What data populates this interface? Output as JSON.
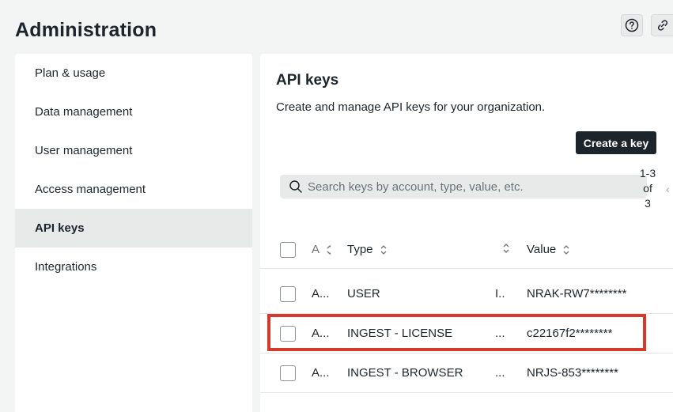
{
  "page": {
    "title": "Administration"
  },
  "top_icons": [
    {
      "name": "help-icon"
    },
    {
      "name": "link-icon"
    }
  ],
  "sidebar": {
    "items": [
      {
        "label": "Plan & usage",
        "active": false
      },
      {
        "label": "Data management",
        "active": false
      },
      {
        "label": "User management",
        "active": false
      },
      {
        "label": "Access management",
        "active": false
      },
      {
        "label": "API keys",
        "active": true
      },
      {
        "label": "Integrations",
        "active": false
      }
    ]
  },
  "main": {
    "title": "API keys",
    "description": "Create and manage API keys for your organization.",
    "create_button": "Create a key",
    "search": {
      "placeholder": "Search keys by account, type, value, etc.",
      "value": ""
    },
    "pager": {
      "line1": "1-3",
      "line2": "of",
      "line3": "3"
    },
    "table": {
      "columns": {
        "account": "A",
        "type": "Type",
        "value": "Value"
      },
      "rows": [
        {
          "account": "A...",
          "type": "USER",
          "mid": "I...",
          "value": "NRAK-RW7********"
        },
        {
          "account": "A...",
          "type": "INGEST - LICENSE",
          "mid": "...",
          "value": "c22167f2********"
        },
        {
          "account": "A...",
          "type": "INGEST - BROWSER",
          "mid": "...",
          "value": "NRJS-853********"
        }
      ]
    }
  },
  "colors": {
    "highlight": "#d4392c",
    "primary_button": "#1d252c",
    "active_nav": "#e8eaea"
  }
}
